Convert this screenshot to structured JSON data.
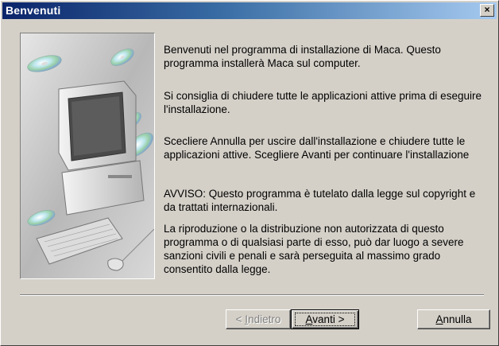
{
  "window": {
    "title": "Benvenuti",
    "close_label": "×"
  },
  "paragraphs": [
    "Benvenuti nel programma di installazione di Maca. Questo programma installerà Maca sul computer.",
    "Si consiglia di chiudere tutte le applicazioni attive prima di eseguire l'installazione.",
    "Scecliere Annulla per uscire dall'installazione e chiudere tutte le applicazioni attive. Scegliere Avanti per continuare l'installazione",
    "AVVISO: Questo programma è tutelato dalla legge sul copyright e da trattati internazionali.",
    "La riproduzione o la distribuzione non autorizzata di questo programma o di qualsiasi parte di esso, può dar luogo a severe sanzioni civili e penali e sarà perseguita al massimo grado consentito dalla legge."
  ],
  "buttons": {
    "back_prefix": "< ",
    "back_access": "I",
    "back_rest": "ndietro",
    "next_access": "A",
    "next_rest": "vanti >",
    "cancel_access": "A",
    "cancel_rest": "nnulla"
  },
  "illustration": {
    "icon": "computer-with-cds-icon"
  }
}
